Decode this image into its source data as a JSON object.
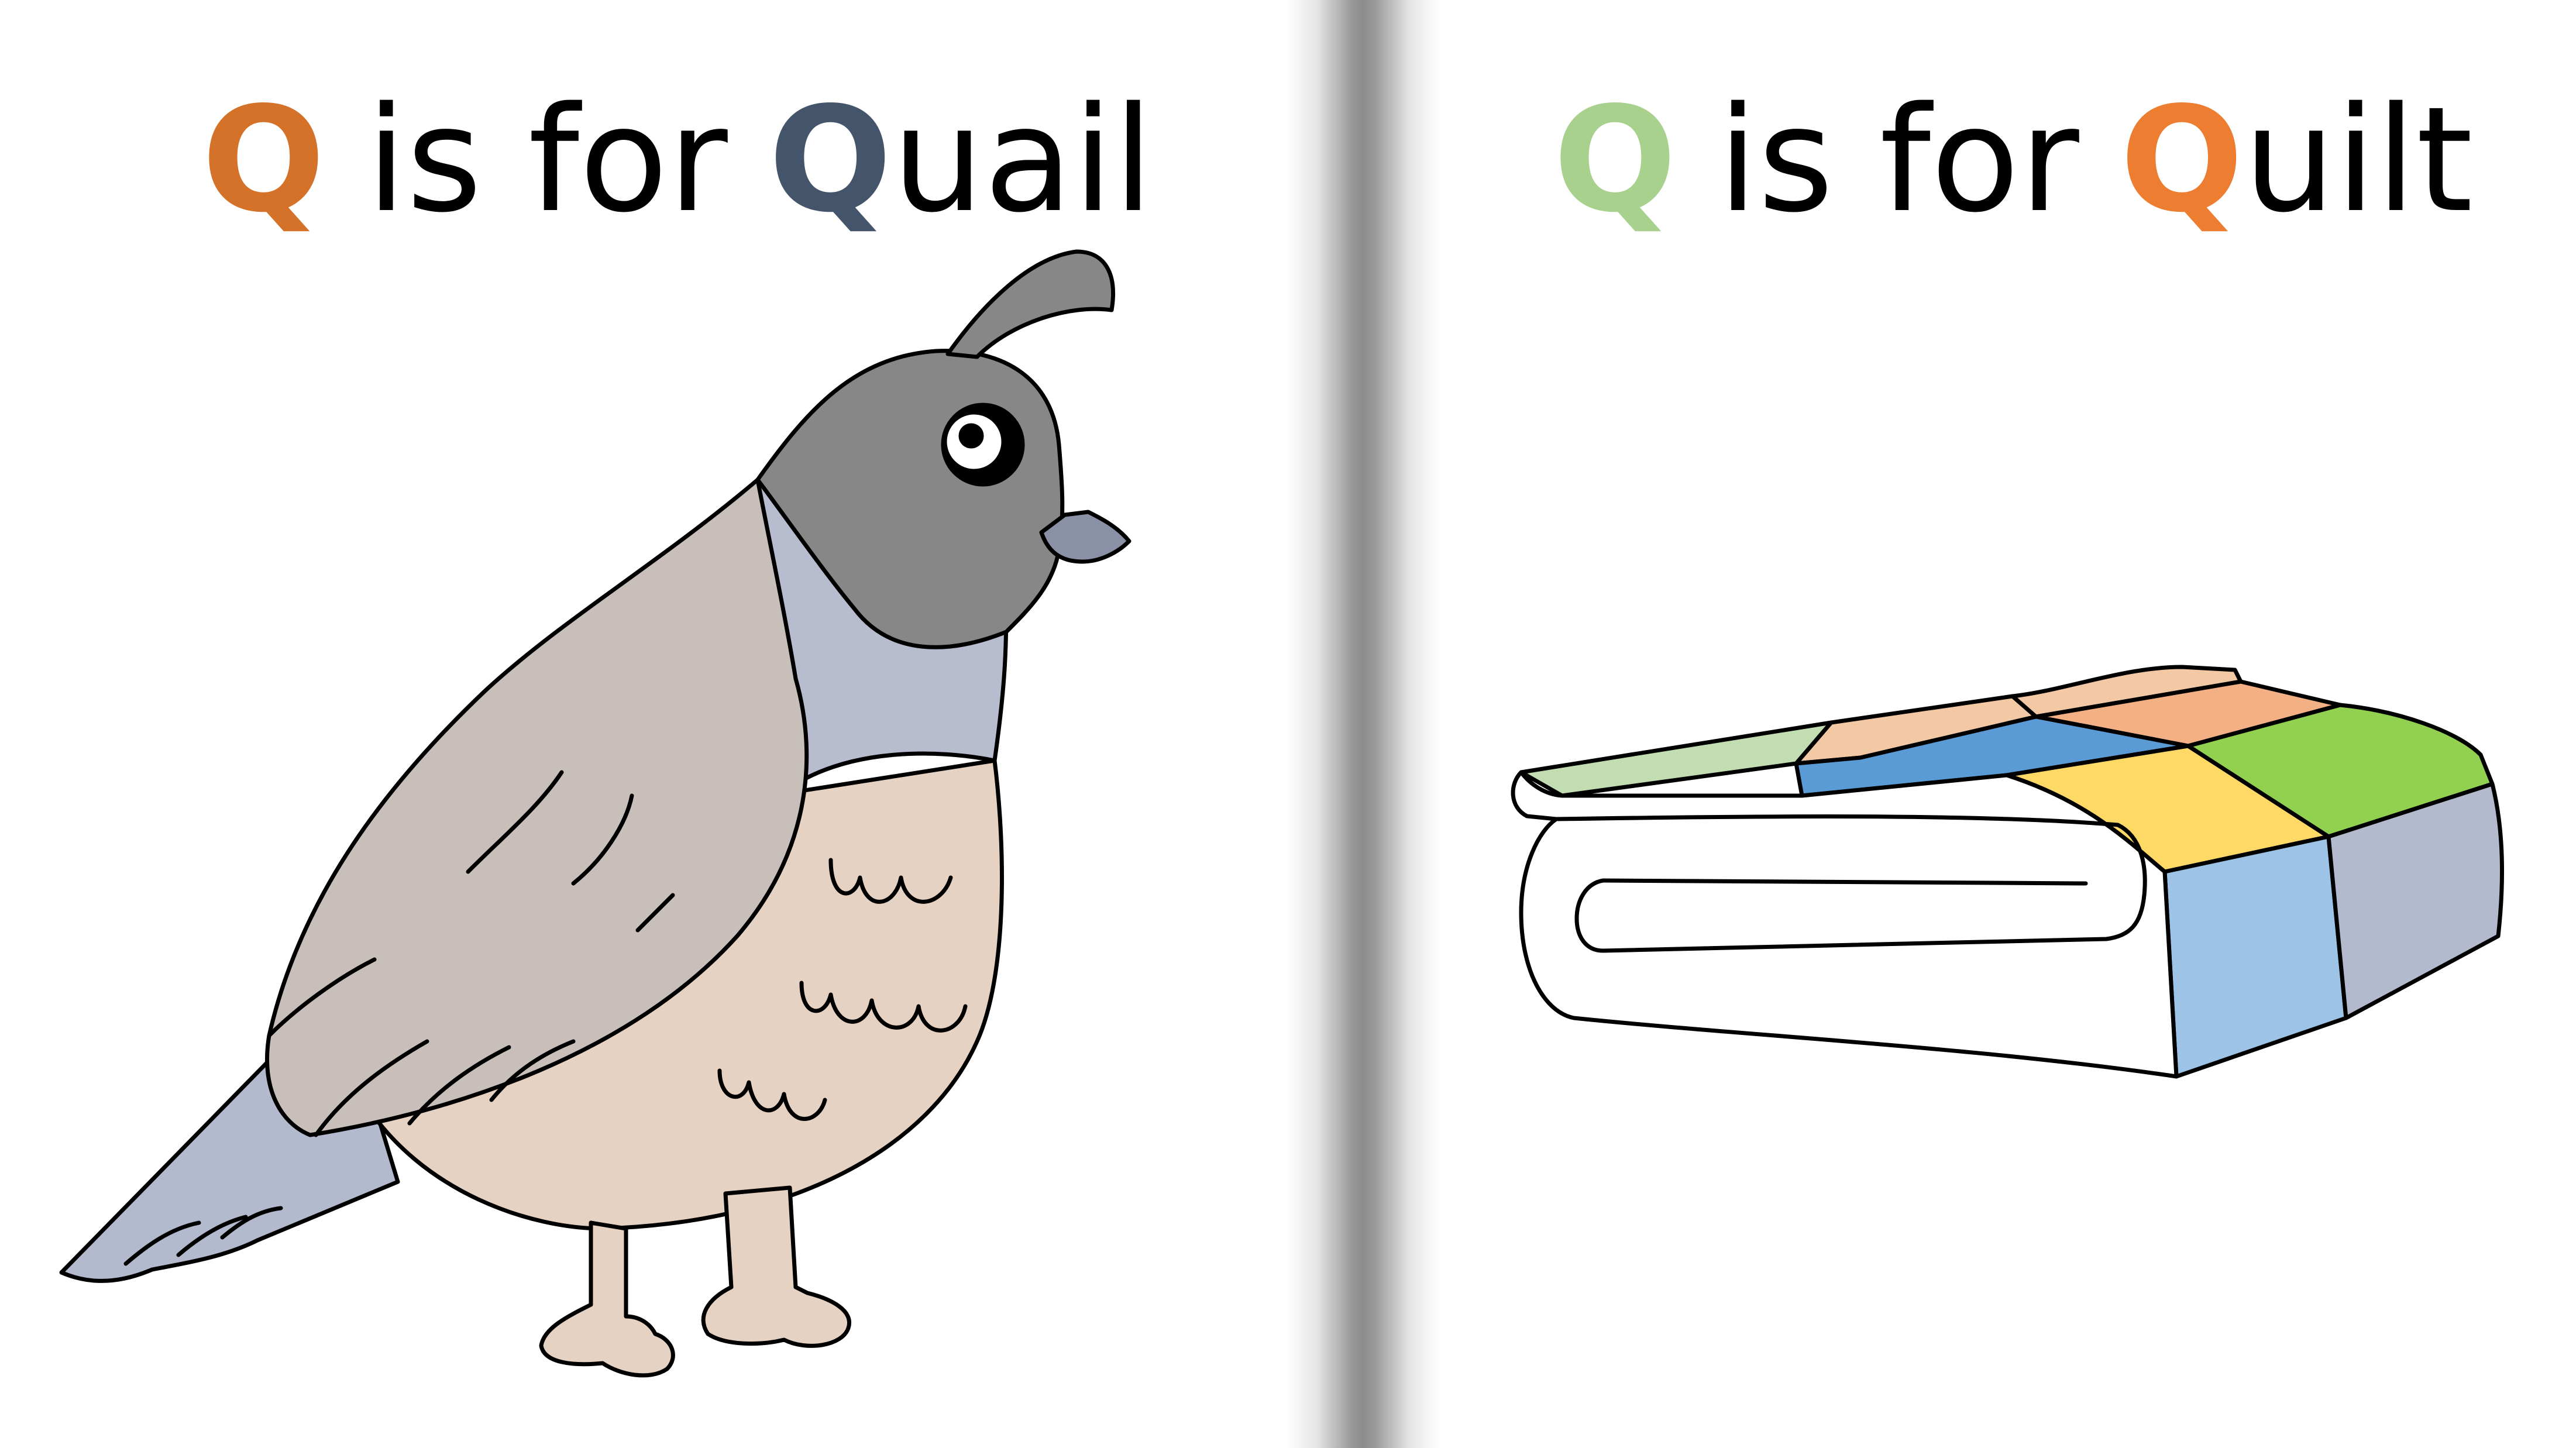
{
  "panels": {
    "left": {
      "letter": "Q",
      "connector": "is for",
      "word_first_letter": "Q",
      "word_rest": "uail",
      "letter_color": "#D4722A",
      "word_letter_color": "#44546A",
      "illustration_icon": "quail-icon"
    },
    "right": {
      "letter": "Q",
      "connector": "is for",
      "word_first_letter": "Q",
      "word_rest": "uilt",
      "letter_color": "#A9D18E",
      "word_letter_color": "#ED7D31",
      "illustration_icon": "folded-quilt-icon"
    }
  },
  "colors": {
    "background": "#FFFFFF",
    "text": "#000000",
    "divider_shadow": "#8C8C8C"
  }
}
